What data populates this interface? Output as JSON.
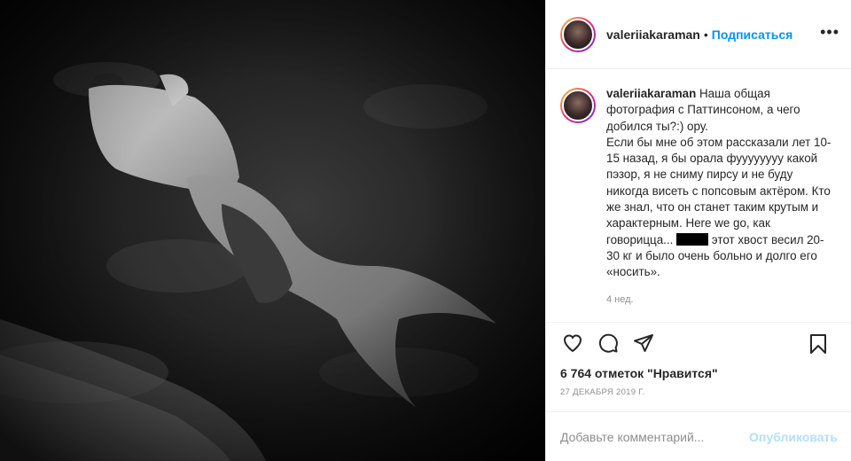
{
  "post": {
    "username": "valeriiakaraman",
    "dot": "•",
    "follow_label": "Подписаться",
    "more_icon": "more-horizontal-icon"
  },
  "caption": {
    "username": "valeriiakaraman",
    "line1": "Наша общая фотография с Паттинсоном, а чего добился ты?:) ору.",
    "line2": "Если бы мне об этом рассказали лет 10-15 назад, я бы орала фуууууууу какой пэзор, я не сниму пирсу и не буду никогда висеть с попсовым актёром. Кто же знал, что он станет таким крутым и характерным. Here we go, как говорицца...",
    "line3": "этот хвост весил 20-30 кг и было очень больно и долго его «носить».",
    "time_ago": "4 нед."
  },
  "actions": {
    "like_icon": "heart-icon",
    "comment_icon": "comment-icon",
    "share_icon": "share-icon",
    "save_icon": "bookmark-icon"
  },
  "likes": "6 764 отметок \"Нравится\"",
  "date": "27 ДЕКАБРЯ 2019 Г.",
  "comment": {
    "placeholder": "Добавьте комментарий...",
    "publish_label": "Опубликовать"
  },
  "colors": {
    "accent": "#0095f6",
    "publish_disabled": "#b2dffc",
    "secondary_text": "#8e8e8e",
    "border": "#efefef"
  }
}
